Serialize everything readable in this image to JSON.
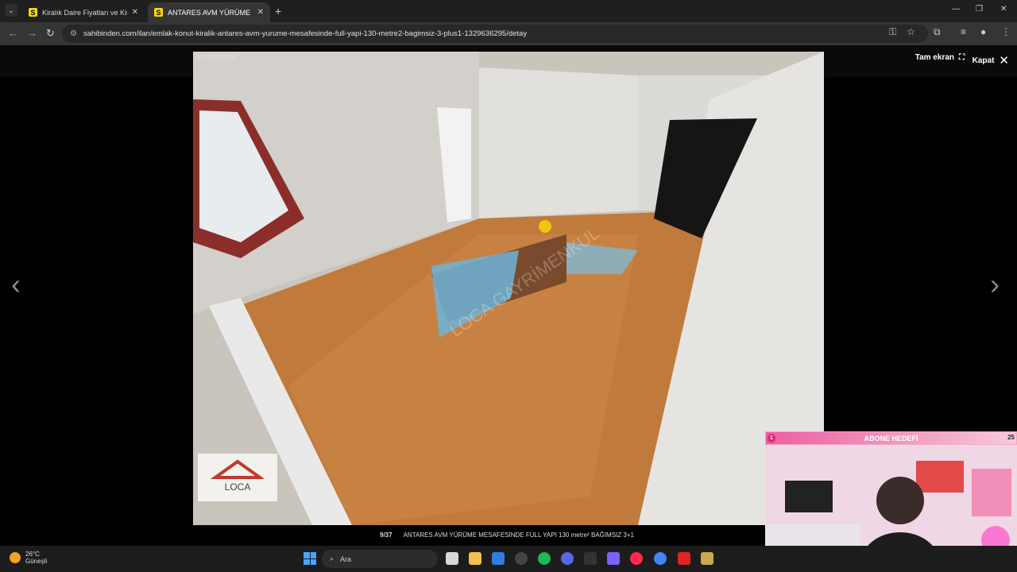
{
  "browser": {
    "tabs": [
      {
        "title": "Kiralık Daire Fiyatları ve Kiralık E",
        "favicon": "S",
        "active": false
      },
      {
        "title": "ANTARES AVM YÜRÜME MESAF",
        "favicon": "S",
        "active": true
      }
    ],
    "url": "sahibinden.com/ilan/emlak-konut-kiralik-antares-avm-yurume-mesafesinde-full-yapi-130-metre2-bagimsiz-3-plus1-1329636295/detay"
  },
  "viewer": {
    "fullscreen_label": "Tam ekran",
    "close_label": "Kapat",
    "photo_id": "#1329636295",
    "counter": "9/37",
    "caption": "ANTARES AVM YÜRÜME MESAFESİNDE FULL YAPI 130 metre² BAĞIMSIZ 3+1",
    "logo_text": "LOCA",
    "watermark": "LOCA GAYRİMENKUL"
  },
  "overlay": {
    "goal_title": "ABONE HEDEFİ",
    "goal_start": "1",
    "goal_end": "25"
  },
  "taskbar": {
    "temperature": "26°C",
    "weather": "Güneşli",
    "search_placeholder": "Ara"
  },
  "colors": {
    "accent_yellow": "#ffd800",
    "goal_pink": "#ec5fa0"
  }
}
